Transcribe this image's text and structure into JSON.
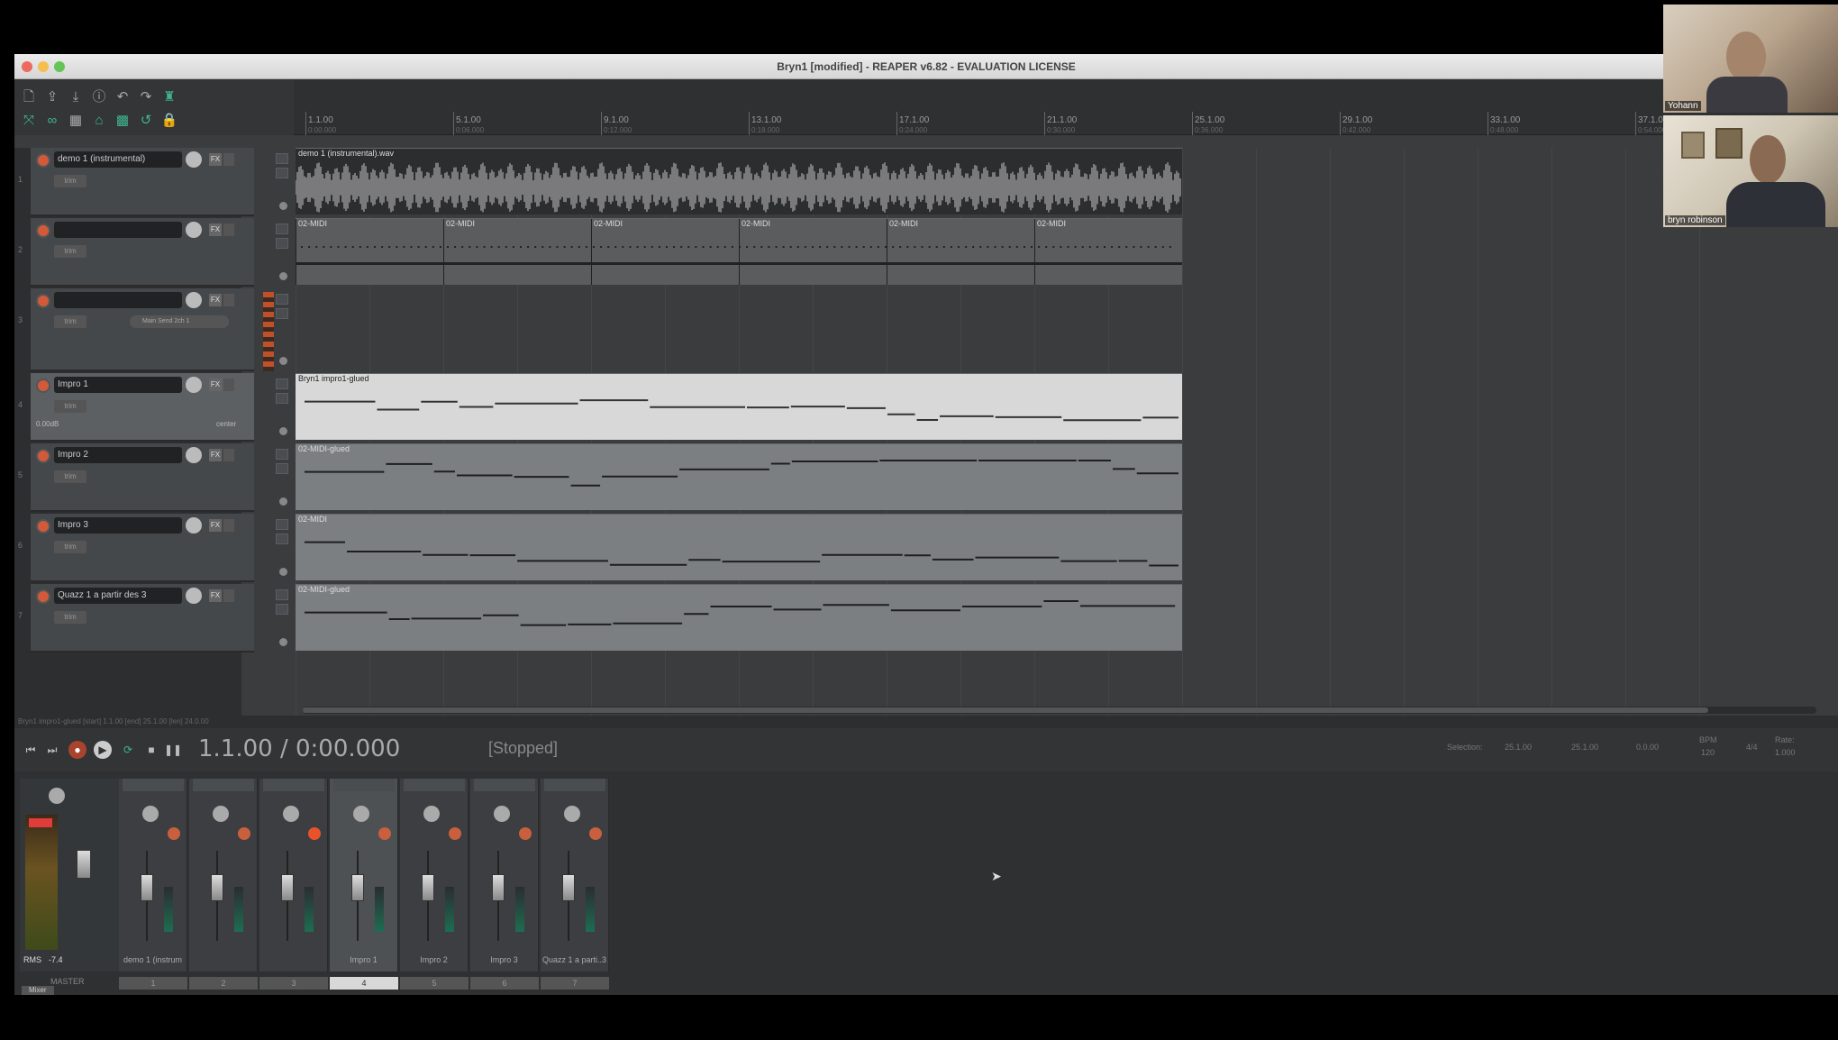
{
  "window": {
    "title": "Bryn1 [modified] - REAPER v6.82 - EVALUATION LICENSE"
  },
  "ruler": {
    "marks": [
      {
        "label": "1.1.00",
        "sub": "0:00.000"
      },
      {
        "label": "5.1.00",
        "sub": "0:06.000"
      },
      {
        "label": "9.1.00",
        "sub": "0:12.000"
      },
      {
        "label": "13.1.00",
        "sub": "0:18.000"
      },
      {
        "label": "17.1.00",
        "sub": "0:24.000"
      },
      {
        "label": "21.1.00",
        "sub": "0:30.000"
      },
      {
        "label": "25.1.00",
        "sub": "0:36.000"
      },
      {
        "label": "29.1.00",
        "sub": "0:42.000"
      },
      {
        "label": "33.1.00",
        "sub": "0:48.000"
      },
      {
        "label": "37.1.00",
        "sub": "0:54.000"
      }
    ]
  },
  "tracks": [
    {
      "num": "1",
      "name": "demo 1 (instrumental)",
      "trim": "trim"
    },
    {
      "num": "2",
      "name": "",
      "trim": "trim"
    },
    {
      "num": "3",
      "name": "",
      "trim": "trim",
      "send": "Main Send 2ch 1"
    },
    {
      "num": "4",
      "name": "Impro 1",
      "trim": "trim",
      "vol": "0.00dB",
      "pan": "center"
    },
    {
      "num": "5",
      "name": "Impro 2",
      "trim": "trim"
    },
    {
      "num": "6",
      "name": "Impro 3",
      "trim": "trim"
    },
    {
      "num": "7",
      "name": "Quazz 1 a partir des 3",
      "trim": "trim"
    }
  ],
  "items": [
    {
      "label": "demo 1 (instrumental).wav",
      "type": "audio"
    },
    {
      "labels": [
        "02-MIDI",
        "02-MIDI",
        "02-MIDI",
        "02-MIDI",
        "02-MIDI",
        "02-MIDI"
      ],
      "type": "midi-dots"
    },
    {
      "label": "",
      "type": "empty"
    },
    {
      "label": "Bryn1 impro1-glued",
      "type": "midi-light"
    },
    {
      "label": "02-MIDI-glued",
      "type": "midi"
    },
    {
      "label": "02-MIDI",
      "type": "midi"
    },
    {
      "label": "02-MIDI-glued",
      "type": "midi"
    }
  ],
  "status_strip": "Bryn1 impro1-glued [start] 1.1.00 [end] 25.1.00 [len] 24.0.00",
  "transport": {
    "time": "1.1.00 / 0:00.000",
    "state": "[Stopped]",
    "selection_label": "Selection:",
    "sel_start": "25.1.00",
    "sel_end": "25.1.00",
    "sel_len": "0.0.00",
    "bpm": "BPM",
    "bpm_value": "120",
    "timesig": "4/4",
    "rate_label": "Rate:",
    "rate": "1.000"
  },
  "mixer": {
    "master_label": "MASTER",
    "rms_label": "RMS",
    "rms_value": "-7.4",
    "mixer_tab": "Mixer",
    "strips": [
      {
        "name": "demo 1 (instrum",
        "num": "1"
      },
      {
        "name": "",
        "num": "2"
      },
      {
        "name": "",
        "num": "3"
      },
      {
        "name": "Impro 1",
        "num": "4"
      },
      {
        "name": "Impro 2",
        "num": "5"
      },
      {
        "name": "Impro 3",
        "num": "6"
      },
      {
        "name": "Quazz 1 a parti..3",
        "num": "7"
      }
    ]
  },
  "video": [
    {
      "name": "Yohann"
    },
    {
      "name": "bryn robinson"
    }
  ],
  "colors": {
    "accent_green": "#3fb58f",
    "record_red": "#c8603e",
    "track_bg": "#45484b",
    "track_selected": "#5d6063"
  }
}
